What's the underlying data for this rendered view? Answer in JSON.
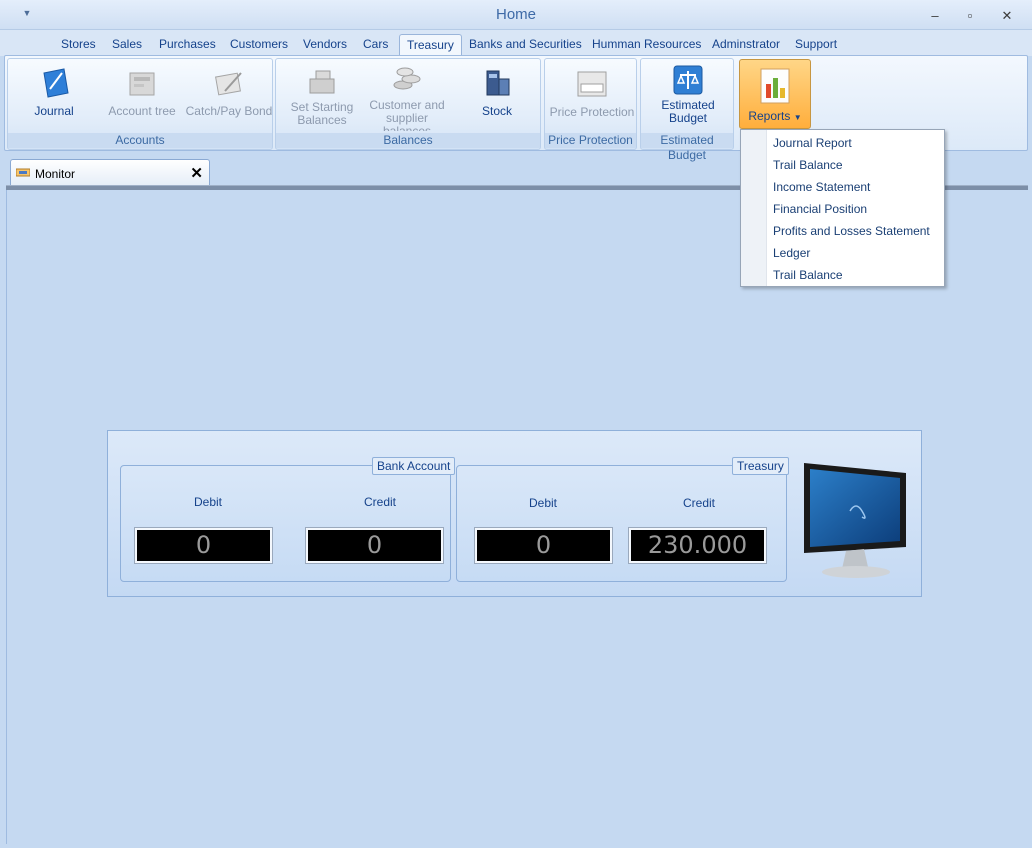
{
  "window": {
    "title": "Home",
    "controls": {
      "minimize": "–",
      "maximize": "▫",
      "close": "✕"
    }
  },
  "tabs": [
    "Stores",
    "Sales",
    "Purchases",
    "Customers",
    "Vendors",
    "Cars",
    "Treasury",
    "Banks and Securities",
    "Humman Resources",
    "Adminstrator",
    "Support"
  ],
  "active_tab": "Treasury",
  "ribbon": {
    "groups": {
      "accounts": "Accounts",
      "balances": "Balances",
      "price_protection": "Price Protection",
      "estimated_budget": "Estimated Budget"
    },
    "buttons": {
      "journal": "Journal",
      "account_tree": "Account tree",
      "catch_pay_bond": "Catch/Pay Bond",
      "set_starting_balances": "Set Starting Balances",
      "customer_supplier_balances": "Customer and supplier balances",
      "stock": "Stock",
      "price_protection": "Price Protection",
      "estimated_budget": "Estimated Budget",
      "reports": "Reports"
    }
  },
  "doc_tab": {
    "label": "Monitor",
    "close": "✕"
  },
  "dashboard": {
    "bank_account": {
      "caption": "Bank Account",
      "debit_label": "Debit",
      "credit_label": "Credit",
      "debit_value": "0",
      "credit_value": "0"
    },
    "treasury": {
      "caption": "Treasury",
      "debit_label": "Debit",
      "credit_label": "Credit",
      "debit_value": "0",
      "credit_value": "230.000"
    }
  },
  "reports_menu": [
    "Journal Report",
    "Trail Balance",
    "Income Statement",
    "Financial Position",
    "Profits and Losses Statement",
    "Ledger",
    "Trail Balance"
  ],
  "colors": {
    "accent": "#15428b",
    "background": "#c5d9f1",
    "reports_highlight": "#ffae3c"
  }
}
